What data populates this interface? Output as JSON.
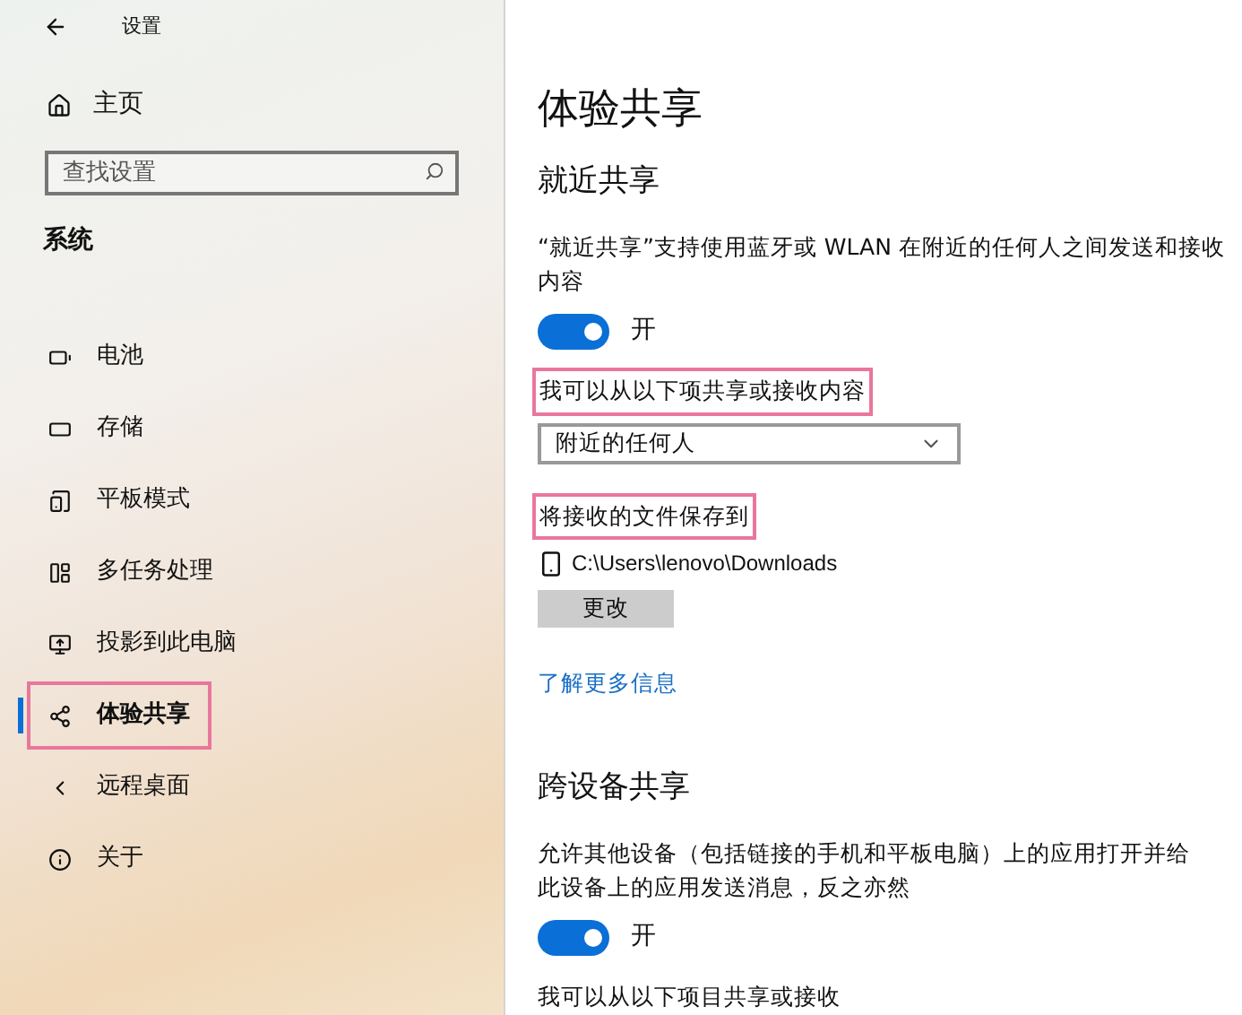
{
  "window": {
    "title": "设置"
  },
  "sidebar": {
    "home": "主页",
    "search": {
      "placeholder": "查找设置"
    },
    "section": "系统",
    "items": [
      {
        "kind": "battery",
        "label": "电池",
        "selected": false,
        "highlighted": false
      },
      {
        "kind": "storage",
        "label": "存储",
        "selected": false,
        "highlighted": false
      },
      {
        "kind": "tablet",
        "label": "平板模式",
        "selected": false,
        "highlighted": false
      },
      {
        "kind": "multitask",
        "label": "多任务处理",
        "selected": false,
        "highlighted": false
      },
      {
        "kind": "project",
        "label": "投影到此电脑",
        "selected": false,
        "highlighted": false
      },
      {
        "kind": "share",
        "label": "体验共享",
        "selected": true,
        "highlighted": true
      },
      {
        "kind": "remote",
        "label": "远程桌面",
        "selected": false,
        "highlighted": false
      },
      {
        "kind": "about",
        "label": "关于",
        "selected": false,
        "highlighted": false
      }
    ]
  },
  "page": {
    "title": "体验共享",
    "nearby": {
      "heading": "就近共享",
      "description": "“就近共享”支持使用蓝牙或 WLAN 在附近的任何人之间发送和接收内容",
      "toggle": {
        "on": true,
        "label": "开"
      },
      "share_with": {
        "label": "我可以从以下项共享或接收内容",
        "highlighted": true,
        "value": "附近的任何人"
      },
      "save_to": {
        "label": "将接收的文件保存到",
        "highlighted": true,
        "path": "C:\\Users\\lenovo\\Downloads",
        "button": "更改"
      },
      "link": "了解更多信息"
    },
    "cross_device": {
      "heading": "跨设备共享",
      "description": "允许其他设备（包括链接的手机和平板电脑）上的应用打开并给此设备上的应用发送消息，反之亦然",
      "toggle": {
        "on": true,
        "label": "开"
      },
      "label": "我可以从以下项目共享或接收"
    }
  }
}
